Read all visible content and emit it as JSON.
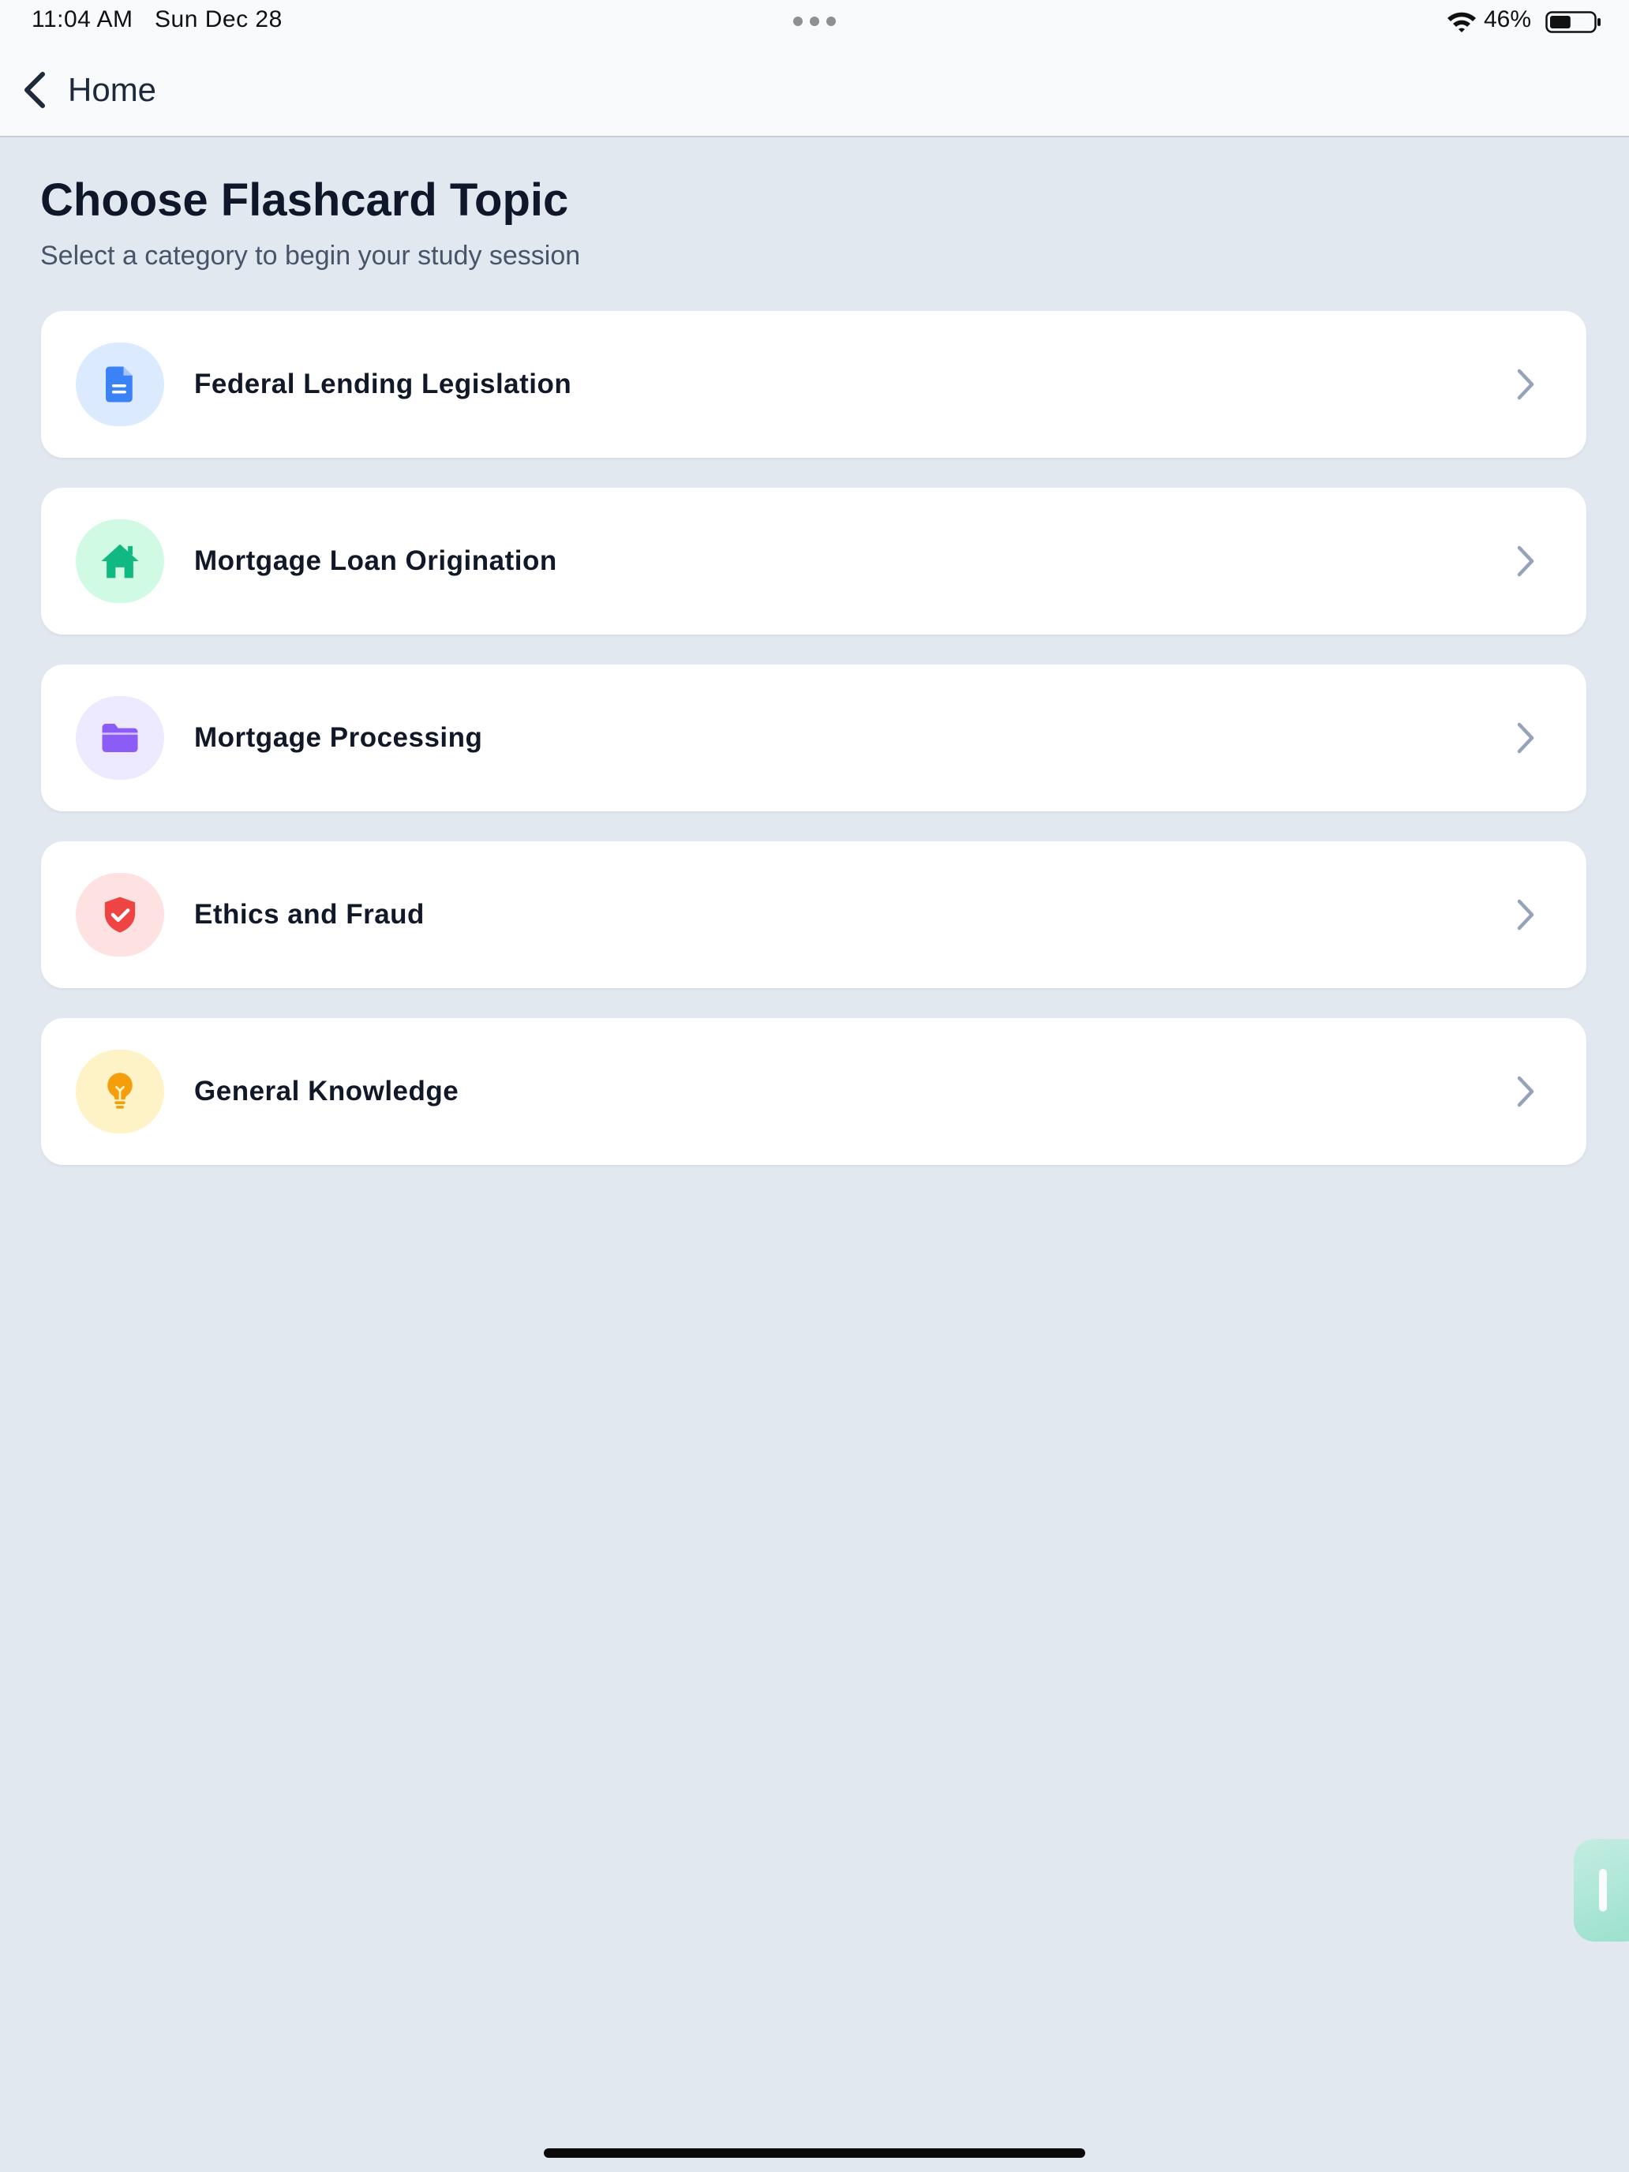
{
  "status_bar": {
    "time": "11:04 AM",
    "date": "Sun Dec 28",
    "battery_percent": "46%",
    "battery_level": 0.46
  },
  "nav": {
    "back_label": "Home",
    "back_icon": "chevron-left-icon"
  },
  "header": {
    "title": "Choose Flashcard Topic",
    "subtitle": "Select a category to begin your study session"
  },
  "topics": [
    {
      "label": "Federal Lending Legislation",
      "icon": "document-icon",
      "icon_color": "#3b82f6",
      "icon_bg": "#dbeafe"
    },
    {
      "label": "Mortgage Loan Origination",
      "icon": "house-icon",
      "icon_color": "#10b981",
      "icon_bg": "#d1fae5"
    },
    {
      "label": "Mortgage Processing",
      "icon": "folder-icon",
      "icon_color": "#8b5cf6",
      "icon_bg": "#ede9fe"
    },
    {
      "label": "Ethics and Fraud",
      "icon": "shield-check-icon",
      "icon_color": "#ef4444",
      "icon_bg": "#fee2e2"
    },
    {
      "label": "General Knowledge",
      "icon": "lightbulb-icon",
      "icon_color": "#f59e0b",
      "icon_bg": "#fef3c7"
    }
  ],
  "colors": {
    "background": "#e2e8f0",
    "bar_background": "#f8fafc",
    "chevron": "#94a3b8"
  }
}
